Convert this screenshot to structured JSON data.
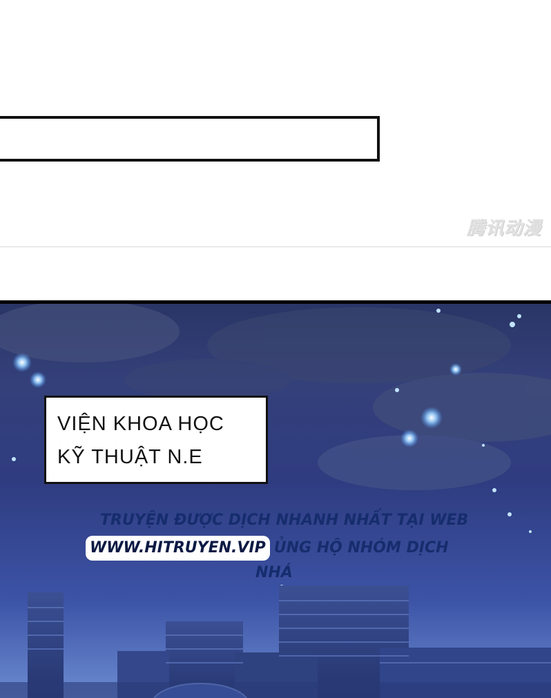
{
  "panels": {
    "top": {
      "watermark": "腾讯动漫"
    },
    "scene": {
      "caption": {
        "line1": "VIỆN KHOA HỌC",
        "line2": "KỸ THUẬT N.E"
      },
      "credit": {
        "line1": "TRUYỆN ĐƯỢC DỊCH NHANH NHẤT TẠI WEB",
        "site": "WWW.HITRUYEN.VIP",
        "line2_rest": "ỦNG HỘ NHÓM DỊCH",
        "line3": "NHÁ"
      }
    }
  },
  "colors": {
    "sky_top": "#2a3566",
    "sky_bottom": "#6b8bd0",
    "credit_text": "#162d6d",
    "border": "#111111"
  }
}
